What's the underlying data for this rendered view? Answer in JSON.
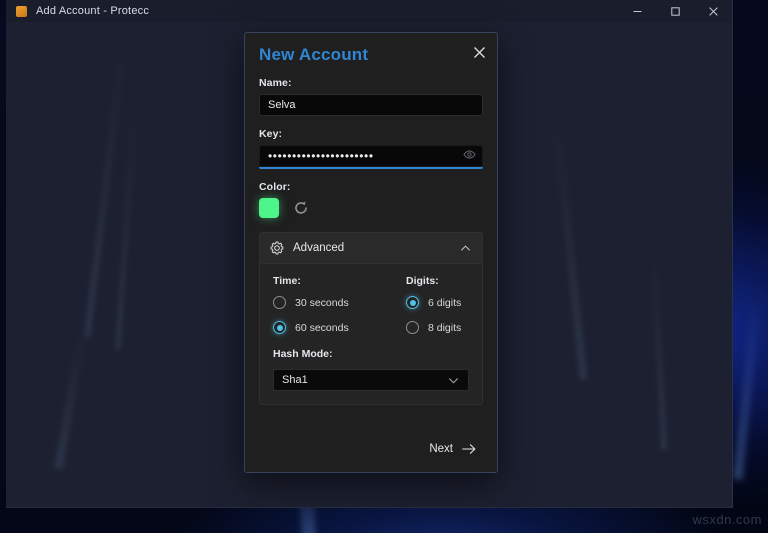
{
  "window": {
    "title": "Add Account - Protecc",
    "app_icon": "app-icon",
    "controls": {
      "minimize": "minimize-icon",
      "maximize": "maximize-icon",
      "close": "close-icon"
    }
  },
  "desktop": {
    "watermark": "wsxdn.com"
  },
  "dialog": {
    "title": "New Account",
    "close_icon": "close-icon",
    "accent_color": "#2f86d4",
    "name": {
      "label": "Name:",
      "value": "Selva",
      "placeholder": ""
    },
    "key": {
      "label": "Key:",
      "value": "••••••••••••••••••••••",
      "placeholder": "",
      "reveal_icon": "eye-icon",
      "focused": true
    },
    "color": {
      "label": "Color:",
      "swatch_color": "#4df58a",
      "randomize_icon": "refresh-icon"
    },
    "advanced": {
      "label": "Advanced",
      "gear_icon": "gear-icon",
      "expanded": true,
      "toggle_icon": "chevron-up-icon",
      "time": {
        "label": "Time:",
        "options": [
          {
            "label": "30 seconds",
            "selected": false
          },
          {
            "label": "60 seconds",
            "selected": true
          }
        ]
      },
      "digits": {
        "label": "Digits:",
        "options": [
          {
            "label": "6 digits",
            "selected": true
          },
          {
            "label": "8 digits",
            "selected": false
          }
        ]
      },
      "hash_mode": {
        "label": "Hash Mode:",
        "value": "Sha1",
        "chevron_icon": "chevron-down-icon"
      },
      "selected_radio_color": "#4fc3e8"
    },
    "footer": {
      "next_label": "Next",
      "next_icon": "arrow-right-icon"
    }
  }
}
